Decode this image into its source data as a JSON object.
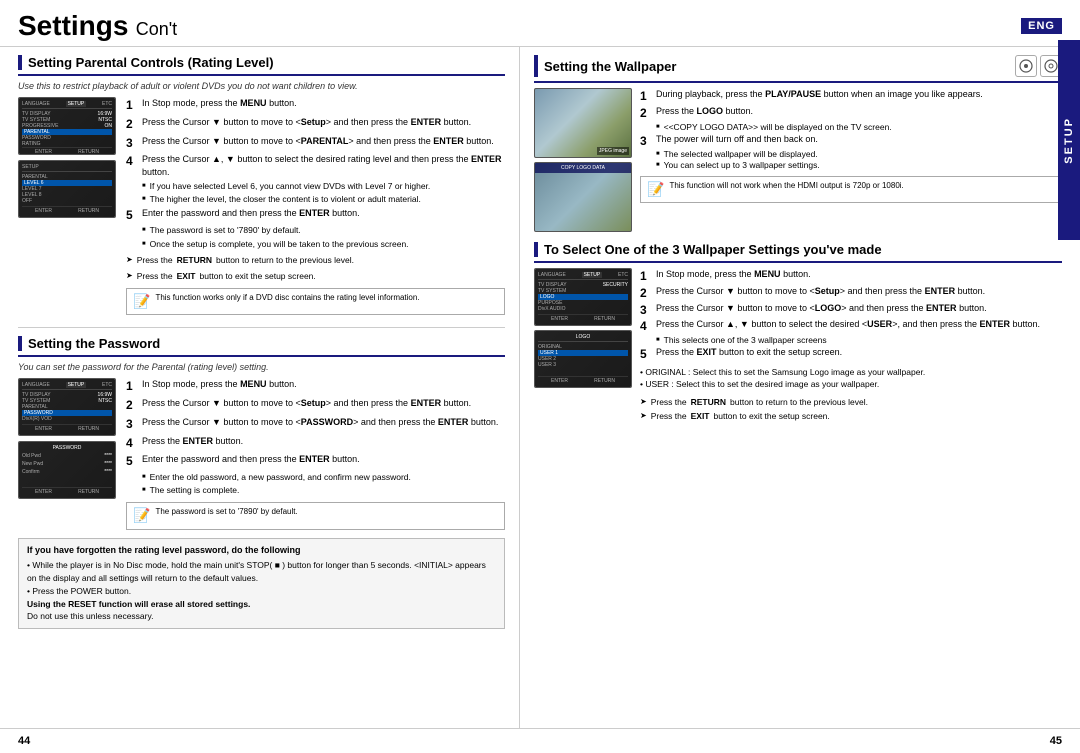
{
  "header": {
    "title": "Settings",
    "subtitle": "Con't",
    "eng_badge": "ENG"
  },
  "left_column": {
    "section1": {
      "title": "Setting Parental Controls (Rating Level)",
      "italic_note": "Use this to restrict playback of adult or violent DVDs you do not want children to view.",
      "steps": [
        {
          "num": "1",
          "text": "In Stop mode, press the ",
          "bold": "MENU",
          "after": " button."
        },
        {
          "num": "2",
          "text": "Press the Cursor ▼ button to move to <",
          "bold_mid": "Setup",
          "after_mid": "> and then press the ",
          "bold_end": "ENTER",
          "final": " button."
        },
        {
          "num": "3",
          "text": "Press the Cursor ▼ button to move to <",
          "bold_mid": "PARENTAL",
          "after_mid": "> and then press the ",
          "bold_end": "ENTER",
          "final": " button."
        },
        {
          "num": "4",
          "text": "Press the Cursor ▲, ▼ button to select the desired rating level and then press the ",
          "bold_end": "ENTER",
          "final": " button."
        },
        {
          "num": "5",
          "text": "Enter the password and then press the ",
          "bold_end": "ENTER",
          "final": " button."
        }
      ],
      "bullet_notes_4": [
        "If you have selected Level 6, you cannot view DVDs with Level 7 or higher.",
        "The higher the level, the closer the content is to violent or adult material."
      ],
      "bullet_notes_5": [
        "The password is set to '7890' by default.",
        "Once the setup is complete, you will be taken to the previous screen."
      ],
      "arrow_notes": [
        "Press the RETURN button to return to the previous level.",
        "Press the EXIT button to exit the setup screen."
      ],
      "info_note": "This function works only if a DVD disc contains the rating level information."
    },
    "section2": {
      "title": "Setting the Password",
      "italic_note": "You can set the password for the Parental (rating level) setting.",
      "steps": [
        {
          "num": "1",
          "text": "In Stop mode, press the ",
          "bold": "MENU",
          "after": " button."
        },
        {
          "num": "2",
          "text": "Press the Cursor ▼ button to move to <Setup> and then press the ENTER button."
        },
        {
          "num": "3",
          "text": "Press the Cursor ▼ button to move to <PASSWORD> and then press the ENTER button."
        },
        {
          "num": "4",
          "text": "Press the ",
          "bold_end": "ENTER",
          "final": " button."
        },
        {
          "num": "5",
          "text": "Enter the password and then press the ",
          "bold_end": "ENTER",
          "final": " button."
        }
      ],
      "bullet_notes_5": [
        "Enter the old password, a new password, and confirm new password.",
        "The setting is complete."
      ],
      "info_note": "The password is set to '7890' by default."
    },
    "warning_box": {
      "title": "If you have forgotten the rating level password, do the following",
      "text1": "• While the player is in No Disc mode, hold the main unit's STOP( ■ ) button for longer than 5 seconds. <INITIAL> appears on the display and all settings will return to the default values.",
      "text2": "• Press the POWER button.",
      "bold1": "Using the RESET function will erase all stored settings.",
      "text3": "Do not use this unless necessary."
    }
  },
  "right_column": {
    "section1": {
      "title": "Setting the Wallpaper",
      "steps": [
        {
          "num": "1",
          "text": "During playback, press the PLAY/PAUSE button when an image you like appears."
        },
        {
          "num": "2",
          "text": "Press the LOGO button."
        },
        {
          "num": "3",
          "text": "The power will turn off and then back on."
        }
      ],
      "bullet_notes_2": [
        "<<COPY LOGO DATA>> will be displayed on the TV screen."
      ],
      "bullet_notes_3": [
        "The selected wallpaper will be displayed.",
        "You can select up to 3 wallpaper settings."
      ],
      "info_note": "This function will not work when the HDMI output is 720p or 1080i."
    },
    "section2": {
      "title": "To Select One of the 3 Wallpaper Settings you've made",
      "steps": [
        {
          "num": "1",
          "text": "In Stop mode, press the MENU button."
        },
        {
          "num": "2",
          "text": "Press the Cursor ▼ button to move to <Setup> and then press the ENTER button."
        },
        {
          "num": "3",
          "text": "Press the Cursor ▼ button to move to <LOGO> and then press the ENTER button."
        },
        {
          "num": "4",
          "text": "Press the Cursor ▲, ▼ button to select the desired <USER>, and then press the ENTER button."
        },
        {
          "num": "5",
          "text": "Press the EXIT button to exit the setup screen."
        }
      ],
      "bullet_notes_4": [
        "This selects one of the 3 wallpaper screens"
      ],
      "footer_notes": [
        "• ORIGINAL : Select this to set the Samsung Logo image as your wallpaper.",
        "• USER : Select this to set the desired image as your wallpaper."
      ],
      "arrow_notes": [
        "Press the RETURN button to return to the previous level.",
        "Press the EXIT button to exit the setup screen."
      ]
    }
  },
  "page_numbers": {
    "left": "44",
    "right": "45"
  },
  "setup_label": "SETUP"
}
